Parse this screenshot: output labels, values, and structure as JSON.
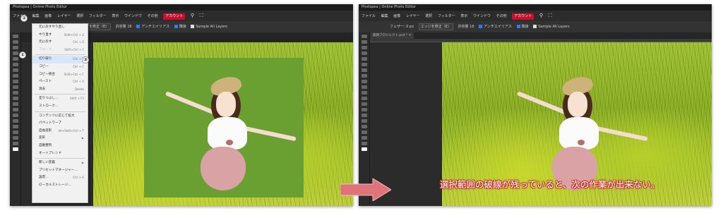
{
  "left_window": {
    "title": "Photopea | Online Photo Editor",
    "menu": [
      "ファイル",
      "編集",
      "画像",
      "レイヤー",
      "選択",
      "フィルター",
      "表示",
      "ウインドウ",
      "その他"
    ],
    "account_label": "アカウント",
    "options": [
      "エッジを修正（E）",
      "許容量 16",
      "アンチエイリアス",
      "隣接",
      "Sample All Layers"
    ],
    "edit_menu": [
      {
        "label": "元に戻すやり直し",
        "shortcut": ""
      },
      {
        "label": "やり直す",
        "shortcut": "Shift+Ctrl + Z"
      },
      {
        "label": "元に戻す",
        "shortcut": "Ctrl + Z"
      },
      {
        "label": "フェード…",
        "shortcut": "Shift+Ctrl + F",
        "disabled": true
      },
      {
        "label": "切り取り",
        "shortcut": "Ctrl + X",
        "highlight": true
      },
      {
        "label": "コピー",
        "shortcut": "Ctrl + C"
      },
      {
        "label": "コピー統合",
        "shortcut": "Shift+Ctrl + C"
      },
      {
        "label": "ペースト",
        "shortcut": "Ctrl + V"
      },
      {
        "label": "消去",
        "shortcut": "Delete"
      },
      {
        "label": "塗りつぶし…",
        "shortcut": "Shift + F5"
      },
      {
        "label": "ストローク…",
        "shortcut": ""
      },
      {
        "label": "コンテンツに応じて拡大",
        "shortcut": ""
      },
      {
        "label": "パペットワープ",
        "shortcut": ""
      },
      {
        "label": "自由変形",
        "shortcut": "Alt+Shift+Ctrl + T"
      },
      {
        "label": "変形",
        "shortcut": "▶"
      },
      {
        "label": "自動整列",
        "shortcut": ""
      },
      {
        "label": "オートブレンド",
        "shortcut": ""
      },
      {
        "label": "新しい定義",
        "shortcut": "▶"
      },
      {
        "label": "プリセットマネージャー…",
        "shortcut": ""
      },
      {
        "label": "設定…",
        "shortcut": "Ctrl + K"
      },
      {
        "label": "ローカルストレージ…",
        "shortcut": ""
      }
    ],
    "badges": [
      "①",
      "②",
      "③"
    ]
  },
  "right_window": {
    "title": "Photopea | Online Photo Editor",
    "menu": [
      "ファイル",
      "編集",
      "画像",
      "レイヤー",
      "選択",
      "フィルター",
      "表示",
      "ウインドウ",
      "その他"
    ],
    "account_label": "アカウント",
    "options": [
      "フェザー: 0 px",
      "エッジを修正（E）",
      "許容量 16",
      "アンチエイリアス",
      "隣接",
      "Sample All Layers"
    ],
    "tab": "無題プロジェクト.psd * ✕"
  },
  "caption": "選択範囲の破線が残っていると、次の作業が出来ない。",
  "colors": {
    "accent_arrow": "#e0737a",
    "caption_outline": "#c8302a",
    "account": "#c8102e",
    "green_fill": "#6aa032"
  }
}
